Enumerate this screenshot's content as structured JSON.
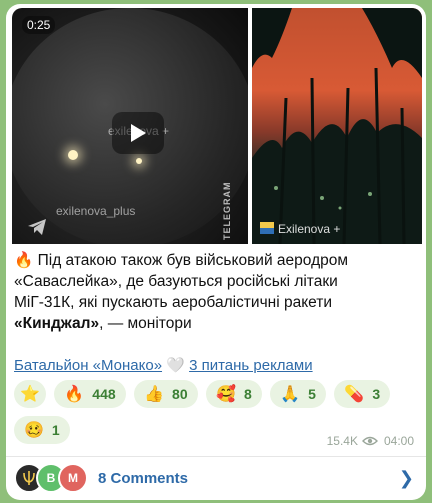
{
  "video": {
    "duration": "0:25",
    "watermark_top": "exilenova +",
    "watermark_bottom": "exilenova_plus",
    "side_text": "TELEGRAM"
  },
  "photo": {
    "watermark": "Exilenova +"
  },
  "caption": {
    "emoji": "🔥",
    "line1": " Під атакою також був військовий аеродром",
    "line2": "«Саваслейка», де базуються російські літаки",
    "line3": "МіГ-31К, які пускають аеробалістичні ракети",
    "bold_word": "«Кинджал»",
    "tail": ", — монітори"
  },
  "links": {
    "channel": "Батальйон «Монако»",
    "heart": "🤍",
    "ads": "3 питань реклами"
  },
  "reactions": [
    {
      "emoji": "⭐",
      "count": ""
    },
    {
      "emoji": "🔥",
      "count": "448"
    },
    {
      "emoji": "👍",
      "count": "80"
    },
    {
      "emoji": "🥰",
      "count": "8"
    },
    {
      "emoji": "🙏",
      "count": "5"
    },
    {
      "emoji": "💊",
      "count": "3"
    },
    {
      "emoji": "🥴",
      "count": "1"
    }
  ],
  "meta": {
    "views": "15.4K",
    "time": "04:00"
  },
  "comments": {
    "avatars": [
      "",
      "В",
      "М"
    ],
    "label": "8 Comments",
    "colors": {
      "a1": "#2a2a2a",
      "a2": "#5fbf6b",
      "a3": "#e0655f"
    }
  }
}
